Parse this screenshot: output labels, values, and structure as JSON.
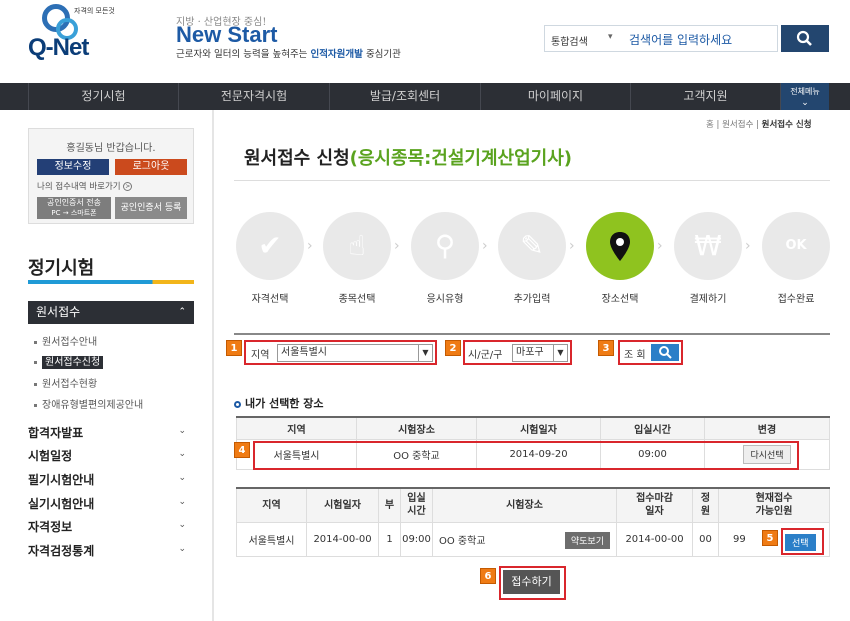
{
  "header": {
    "logo": {
      "tagline": "자격의 모든것",
      "name": "Q-Net"
    },
    "new_start": {
      "subtitle": "지방 · 산업현장 중심!",
      "title": "New Start",
      "desc_pre": "근로자와 일터의 능력을 높혀주는",
      "desc_hl": "인적자원개발",
      "desc_post": "중심기관"
    },
    "search": {
      "scope": "통합검색",
      "placeholder": "검색어를 입력하세요",
      "icon": "search-icon"
    }
  },
  "gnb": {
    "items": [
      "정기시험",
      "전문자격시험",
      "발급/조회센터",
      "마이페이지",
      "고객지원"
    ],
    "all_menu": "전체메뉴"
  },
  "sidebar": {
    "greeting": "홍길동님 반갑습니다.",
    "edit_btn": "정보수정",
    "logout_btn": "로그아웃",
    "my_link": "나의 접수내역 바로가기",
    "cert_send_1": "공인인증서 전송",
    "cert_send_2": "PC → 스마트폰",
    "cert_reg": "공인인증서 등록",
    "title": "정기시험",
    "active_menu": "원서접수",
    "sub_items": [
      "원서접수안내",
      "원서접수신청",
      "원서접수현황",
      "장애유형별편의제공안내"
    ],
    "menus": [
      "합격자발표",
      "시험일정",
      "필기시험안내",
      "실기시험안내",
      "자격정보",
      "자격검정통계"
    ]
  },
  "content": {
    "breadcrumb": {
      "home": "홈",
      "mid": "원서접수",
      "current": "원서접수 신청"
    },
    "title": "원서접수 신청",
    "title_detail": "(응시종목:건설기계산업기사)",
    "steps": [
      "자격선택",
      "종목선택",
      "응시유형",
      "추가입력",
      "장소선택",
      "결제하기",
      "접수완료"
    ],
    "active_step": 4,
    "filter": {
      "region_label": "지역",
      "region_value": "서울특별시",
      "district_label": "시/군/구",
      "district_value": "마포구",
      "query_label": "조 회"
    },
    "badges": [
      "1",
      "2",
      "3",
      "4",
      "5",
      "6"
    ],
    "selected": {
      "heading": "내가 선택한 장소",
      "headers": [
        "지역",
        "시험장소",
        "시험일자",
        "입실시간",
        "변경"
      ],
      "row": {
        "region": "서울특별시",
        "place": "OO 중학교",
        "date": "2014-09-20",
        "time": "09:00",
        "change": "다시선택"
      }
    },
    "list": {
      "headers": [
        "지역",
        "시험일자",
        "부",
        "입실\n시간",
        "시험장소",
        "접수마감\n일자",
        "정\n원",
        "현재접수\n가능인원"
      ],
      "row": {
        "region": "서울특별시",
        "date": "2014-00-00",
        "part": "1",
        "time": "09:00",
        "place": "OO 중학교",
        "map": "약도보기",
        "deadline": "2014-00-00",
        "cap": "00",
        "avail": "99",
        "select": "선택"
      }
    },
    "submit": "접수하기"
  },
  "colors": {
    "navy": "#23466f",
    "green": "#8fc31f",
    "badge": "#ef7b14",
    "highlight": "#d9262c"
  }
}
